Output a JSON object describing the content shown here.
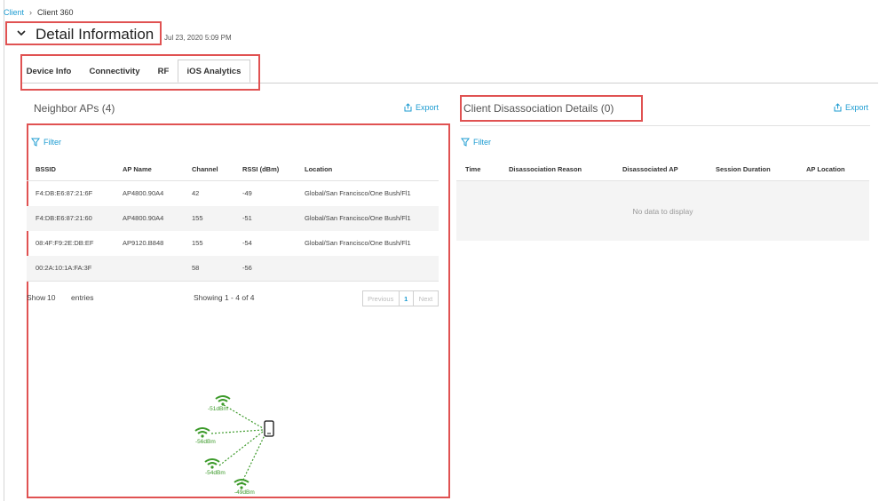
{
  "breadcrumb": {
    "root": "Client",
    "current": "Client 360"
  },
  "header": {
    "title": "Detail Information",
    "timestamp": "Jul 23, 2020 5:09 PM"
  },
  "tabs": [
    {
      "label": "Device Info"
    },
    {
      "label": "Connectivity"
    },
    {
      "label": "RF"
    },
    {
      "label": "iOS Analytics",
      "active": true
    }
  ],
  "neighbor": {
    "title": "Neighbor APs (4)",
    "export": "Export",
    "filter": "Filter",
    "columns": [
      "BSSID",
      "AP Name",
      "Channel",
      "RSSI (dBm)",
      "Location"
    ],
    "rows": [
      [
        "F4:DB:E6:87:21:6F",
        "AP4800.90A4",
        "42",
        "-49",
        "Global/San Francisco/One Bush/Fl1"
      ],
      [
        "F4:DB:E6:87:21:60",
        "AP4800.90A4",
        "155",
        "-51",
        "Global/San Francisco/One Bush/Fl1"
      ],
      [
        "08:4F:F9:2E:DB:EF",
        "AP9120.B848",
        "155",
        "-54",
        "Global/San Francisco/One Bush/Fl1"
      ],
      [
        "00:2A:10:1A:FA:3F",
        "",
        "58",
        "-56",
        ""
      ]
    ],
    "show_label": "Show",
    "show_value": "10",
    "entries_label": "entries",
    "showing": "Showing 1 - 4 of 4",
    "pager": {
      "prev": "Previous",
      "page": "1",
      "next": "Next"
    },
    "diagram_labels": [
      "-51dBm",
      "-56dBm",
      "-54dBm",
      "-49dBm"
    ]
  },
  "disassoc": {
    "title": "Client Disassociation Details (0)",
    "export": "Export",
    "filter": "Filter",
    "columns": [
      "Time",
      "Disassociation Reason",
      "Disassociated AP",
      "Session Duration",
      "AP Location"
    ],
    "empty": "No data to display"
  },
  "colors": {
    "accent": "#1b9bd1",
    "highlight": "#e05252",
    "wifi": "#3c9a2a"
  }
}
